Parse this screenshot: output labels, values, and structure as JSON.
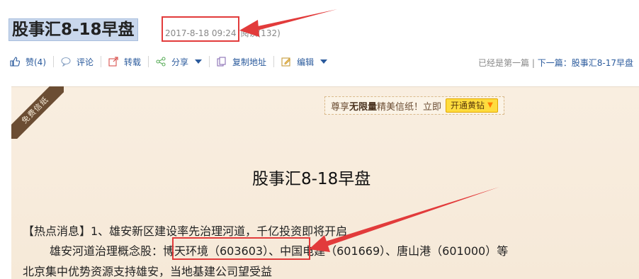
{
  "post": {
    "title": "股事汇8-18早盘",
    "date": "2017-8-18 09:24",
    "reads_label": "阅读(132)"
  },
  "toolbar": {
    "like_label": "赞(4)",
    "comment_label": "评论",
    "repost_label": "转载",
    "share_label": "分享",
    "copy_link_label": "复制地址",
    "edit_label": "编辑"
  },
  "nav": {
    "first_label": "已经是第一篇",
    "divider": "|",
    "next_label": "下一篇：股事汇8-17早盘"
  },
  "stationery": {
    "ribbon_label": "免费信纸",
    "promo_prefix": "尊享",
    "promo_bold": "无限量",
    "promo_suffix": "精美信纸！立即",
    "promo_button": "开通黄钻"
  },
  "content": {
    "heading": "股事汇8-18早盘",
    "line1": "【热点消息】1、雄安新区建设率先治理河道，千亿投资即将开启",
    "line2": "雄安河道治理概念股：博天环境（603603）、中国电建（601669）、唐山港（601000）等",
    "line3": "北京集中优势资源支持雄安，当地基建公司望受益"
  },
  "colors": {
    "link": "#2a5a9c",
    "annotation_red": "#e23b3b",
    "paper": "#f8ecdc"
  },
  "icons": [
    "thumbs-up-icon",
    "comment-icon",
    "repost-icon",
    "share-icon",
    "copy-icon",
    "edit-icon",
    "diamond-icon"
  ]
}
